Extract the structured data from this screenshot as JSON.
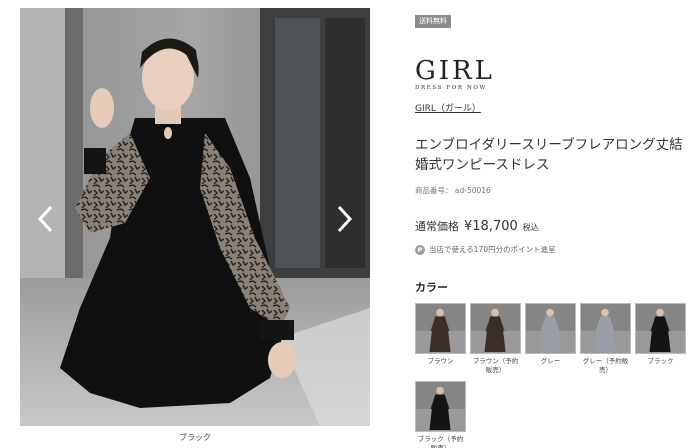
{
  "gallery": {
    "main_image": "model-black-dress-photo",
    "prev_icon": "chevron-left-icon",
    "next_icon": "chevron-right-icon",
    "caption": "ブラック"
  },
  "product": {
    "badge": "送料無料",
    "brand_logo": "GIRL",
    "brand_tagline": "DRESS FOR NOW",
    "brand_link": "GIRL（ガール）",
    "title": "エンブロイダリースリーブフレアロング丈結婚式ワンピースドレス",
    "code": "商品番号： ad-50016",
    "price_label": "通常価格",
    "price": "¥18,700",
    "price_tax": "税込",
    "points_icon": "P",
    "points_text": "当店で使える170円分のポイント進呈"
  },
  "colors": {
    "heading": "カラー",
    "items": [
      {
        "label": "ブラウン",
        "color": "#3a2e26"
      },
      {
        "label": "ブラウン（予約販売）",
        "color": "#3a2e26"
      },
      {
        "label": "グレー",
        "color": "#9a9ea6"
      },
      {
        "label": "グレー（予約販売）",
        "color": "#9a9ea6"
      },
      {
        "label": "ブラック",
        "color": "#141414"
      },
      {
        "label": "ブラック（予約販売）",
        "color": "#141414"
      }
    ]
  }
}
